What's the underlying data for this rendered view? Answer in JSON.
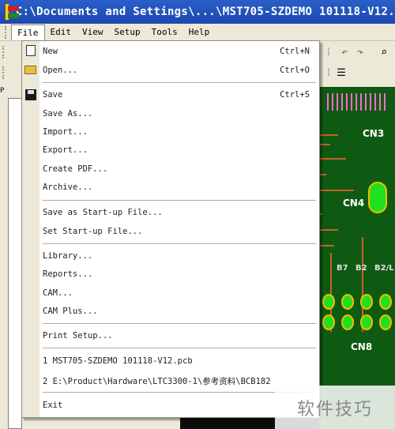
{
  "window": {
    "title": "C:\\Documents and Settings\\...\\MST705-SZDEMO 101118-V12."
  },
  "menubar": {
    "items": [
      "File",
      "Edit",
      "View",
      "Setup",
      "Tools",
      "Help"
    ]
  },
  "side_panel": {
    "tab_label": "P"
  },
  "file_menu": {
    "items": [
      {
        "label": "New",
        "shortcut": "Ctrl+N"
      },
      {
        "label": "Open...",
        "shortcut": "Ctrl+O"
      },
      {
        "label": "Save",
        "shortcut": "Ctrl+S"
      },
      {
        "label": "Save As...",
        "shortcut": ""
      },
      {
        "label": "Import...",
        "shortcut": ""
      },
      {
        "label": "Export...",
        "shortcut": ""
      },
      {
        "label": "Create PDF...",
        "shortcut": ""
      },
      {
        "label": "Archive...",
        "shortcut": ""
      },
      {
        "label": "Save as Start-up File...",
        "shortcut": ""
      },
      {
        "label": "Set Start-up File...",
        "shortcut": ""
      },
      {
        "label": "Library...",
        "shortcut": ""
      },
      {
        "label": "Reports...",
        "shortcut": ""
      },
      {
        "label": "CAM...",
        "shortcut": ""
      },
      {
        "label": "CAM Plus...",
        "shortcut": ""
      },
      {
        "label": "Print Setup...",
        "shortcut": ""
      },
      {
        "label": "1 MST705-SZDEMO 101118-V12.pcb",
        "shortcut": ""
      },
      {
        "label": "2 E:\\Product\\Hardware\\LTC3300-1\\参考资料\\BCB182",
        "shortcut": ""
      },
      {
        "label": "Exit",
        "shortcut": ""
      }
    ]
  },
  "pcb": {
    "labels": [
      "CN3",
      "CN4",
      "CN8"
    ],
    "silk_labels": [
      "B7",
      "B2",
      "B2/L"
    ]
  },
  "watermark": {
    "text": "软件技巧"
  },
  "colors": {
    "titlebar": "#1d48b0",
    "menu_bg": "#ece9d8",
    "pcb_copper": "#0f5a12",
    "pcb_trace": "#c8602a",
    "pcb_pad": "#20e020"
  }
}
